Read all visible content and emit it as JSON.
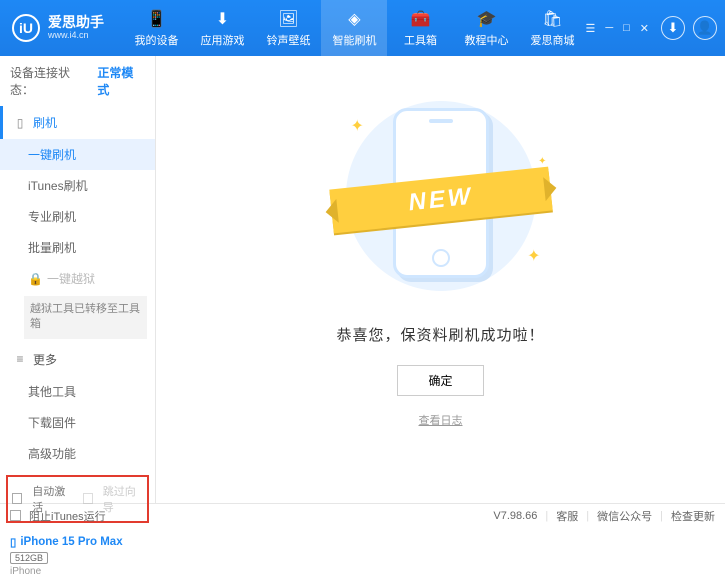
{
  "header": {
    "logo_letter": "iU",
    "app_name": "爱思助手",
    "website": "www.i4.cn",
    "nav": [
      {
        "label": "我的设备",
        "icon": "📱"
      },
      {
        "label": "应用游戏",
        "icon": "⬇"
      },
      {
        "label": "铃声壁纸",
        "icon": "🖼"
      },
      {
        "label": "智能刷机",
        "icon": "◈"
      },
      {
        "label": "工具箱",
        "icon": "🧰"
      },
      {
        "label": "教程中心",
        "icon": "🎓"
      },
      {
        "label": "爱思商城",
        "icon": "🛍"
      }
    ]
  },
  "sidebar": {
    "status_label": "设备连接状态：",
    "status_value": "正常模式",
    "section_flash": "刷机",
    "items_flash": [
      "一键刷机",
      "iTunes刷机",
      "专业刷机",
      "批量刷机"
    ],
    "jailbreak": "一键越狱",
    "jailbreak_note": "越狱工具已转移至工具箱",
    "section_more": "更多",
    "items_more": [
      "其他工具",
      "下载固件",
      "高级功能"
    ],
    "cb_auto_activate": "自动激活",
    "cb_skip_guide": "跳过向导",
    "device_name": "iPhone 15 Pro Max",
    "device_storage": "512GB",
    "device_type": "iPhone"
  },
  "main": {
    "banner_text": "NEW",
    "success_msg": "恭喜您，保资料刷机成功啦！",
    "ok_button": "确定",
    "log_link": "查看日志"
  },
  "footer": {
    "block_itunes": "阻止iTunes运行",
    "version": "V7.98.66",
    "links": [
      "客服",
      "微信公众号",
      "检查更新"
    ]
  }
}
